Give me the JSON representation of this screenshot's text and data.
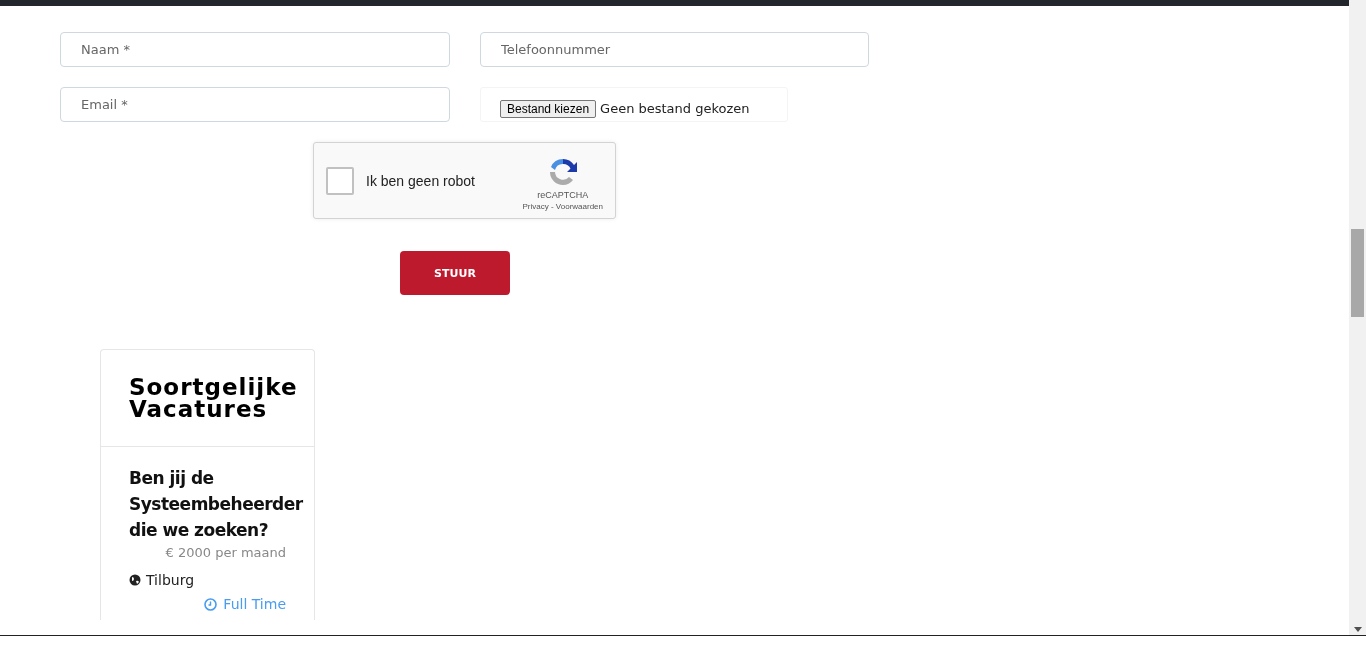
{
  "form": {
    "fields": [
      {
        "placeholder": "Naam *"
      },
      {
        "placeholder": "Telefoonnummer"
      },
      {
        "placeholder": "Email *"
      }
    ],
    "file_upload": {
      "button": "Bestand kiezen",
      "status": "Geen bestand gekozen"
    },
    "captcha": {
      "checked": false,
      "label": "Ik ben geen robot",
      "brand": "reCAPTCHA",
      "links": "Privacy - Voorwaarden"
    },
    "submit": "STUUR"
  },
  "similar_jobs": {
    "title": "Soortgelijke Vacatures",
    "jobs": [
      {
        "title": "Ben jij de Systeembeheerder die we zoeken?",
        "salary": "€ 2000 per maand",
        "location": "Tilburg",
        "type": "Full Time"
      }
    ]
  }
}
